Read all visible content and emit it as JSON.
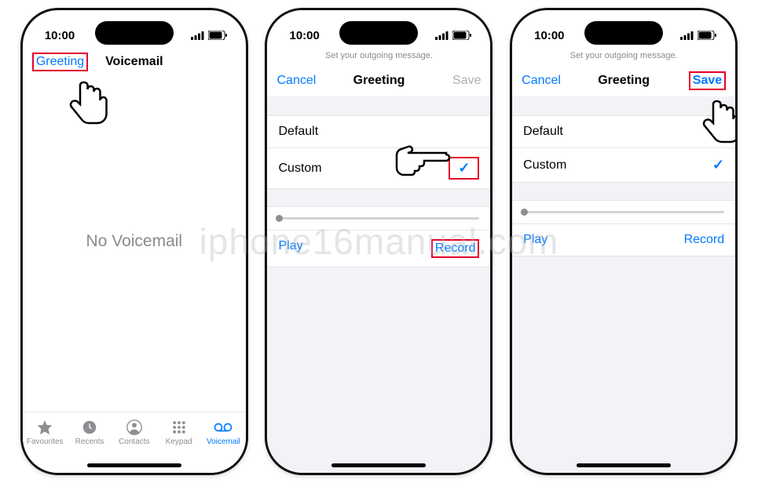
{
  "status": {
    "time": "10:00"
  },
  "screen1": {
    "greeting_btn": "Greeting",
    "title": "Voicemail",
    "empty_text": "No Voicemail",
    "tabs": {
      "favourites": "Favourites",
      "recents": "Recents",
      "contacts": "Contacts",
      "keypad": "Keypad",
      "voicemail": "Voicemail"
    }
  },
  "screen2": {
    "subtitle": "Set your outgoing message.",
    "cancel": "Cancel",
    "title": "Greeting",
    "save": "Save",
    "option_default": "Default",
    "option_custom": "Custom",
    "play": "Play",
    "record": "Record"
  },
  "screen3": {
    "subtitle": "Set your outgoing message.",
    "cancel": "Cancel",
    "title": "Greeting",
    "save": "Save",
    "option_default": "Default",
    "option_custom": "Custom",
    "play": "Play",
    "record": "Record"
  },
  "watermark": "iphone16manual.com"
}
